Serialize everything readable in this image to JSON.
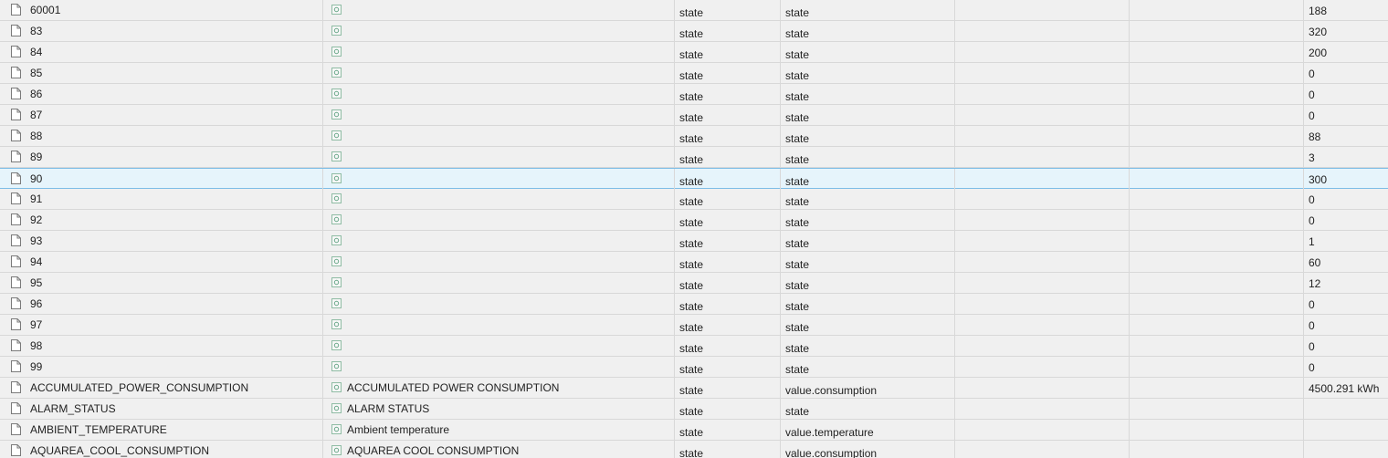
{
  "rows": [
    {
      "id": "60001",
      "name": "",
      "type": "state",
      "role": "state",
      "value": "188",
      "selected": false
    },
    {
      "id": "83",
      "name": "",
      "type": "state",
      "role": "state",
      "value": "320",
      "selected": false
    },
    {
      "id": "84",
      "name": "",
      "type": "state",
      "role": "state",
      "value": "200",
      "selected": false
    },
    {
      "id": "85",
      "name": "",
      "type": "state",
      "role": "state",
      "value": "0",
      "selected": false
    },
    {
      "id": "86",
      "name": "",
      "type": "state",
      "role": "state",
      "value": "0",
      "selected": false
    },
    {
      "id": "87",
      "name": "",
      "type": "state",
      "role": "state",
      "value": "0",
      "selected": false
    },
    {
      "id": "88",
      "name": "",
      "type": "state",
      "role": "state",
      "value": "88",
      "selected": false
    },
    {
      "id": "89",
      "name": "",
      "type": "state",
      "role": "state",
      "value": "3",
      "selected": false
    },
    {
      "id": "90",
      "name": "",
      "type": "state",
      "role": "state",
      "value": "300",
      "selected": true
    },
    {
      "id": "91",
      "name": "",
      "type": "state",
      "role": "state",
      "value": "0",
      "selected": false
    },
    {
      "id": "92",
      "name": "",
      "type": "state",
      "role": "state",
      "value": "0",
      "selected": false
    },
    {
      "id": "93",
      "name": "",
      "type": "state",
      "role": "state",
      "value": "1",
      "selected": false
    },
    {
      "id": "94",
      "name": "",
      "type": "state",
      "role": "state",
      "value": "60",
      "selected": false
    },
    {
      "id": "95",
      "name": "",
      "type": "state",
      "role": "state",
      "value": "12",
      "selected": false
    },
    {
      "id": "96",
      "name": "",
      "type": "state",
      "role": "state",
      "value": "0",
      "selected": false
    },
    {
      "id": "97",
      "name": "",
      "type": "state",
      "role": "state",
      "value": "0",
      "selected": false
    },
    {
      "id": "98",
      "name": "",
      "type": "state",
      "role": "state",
      "value": "0",
      "selected": false
    },
    {
      "id": "99",
      "name": "",
      "type": "state",
      "role": "state",
      "value": "0",
      "selected": false
    },
    {
      "id": "ACCUMULATED_POWER_CONSUMPTION",
      "name": "ACCUMULATED POWER CONSUMPTION",
      "type": "state",
      "role": "value.consumption",
      "value": "4500.291 kWh",
      "selected": false
    },
    {
      "id": "ALARM_STATUS",
      "name": "ALARM STATUS",
      "type": "state",
      "role": "state",
      "value": "",
      "selected": false
    },
    {
      "id": "AMBIENT_TEMPERATURE",
      "name": "Ambient temperature",
      "type": "state",
      "role": "value.temperature",
      "value": "",
      "selected": false
    },
    {
      "id": "AQUAREA_COOL_CONSUMPTION",
      "name": "AQUAREA COOL CONSUMPTION",
      "type": "state",
      "role": "value.consumption",
      "value": "",
      "selected": false
    }
  ],
  "colors": {
    "background": "#f0f0f0",
    "selected_background": "#e6f4fb",
    "selected_border": "#7dbde6",
    "grid_line": "#d8d8d8",
    "state_icon": "#6aa88a"
  },
  "icons": {
    "id_column": "file-icon",
    "name_column": "state-icon"
  }
}
